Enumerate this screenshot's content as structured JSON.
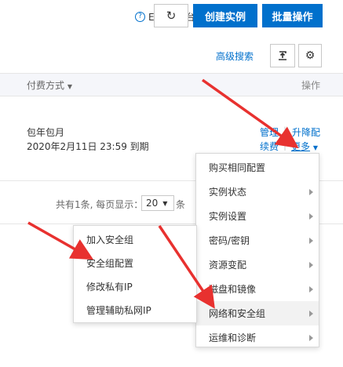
{
  "header": {
    "help_text": "ECS控制台操作指南",
    "refresh_icon": "refresh-icon",
    "create_label": "创建实例",
    "batch_label": "批量操作",
    "primary_color": "#0070cc"
  },
  "toolbar": {
    "advanced_search": "高级搜索",
    "export_icon": "export-icon",
    "settings_icon": "gear-icon"
  },
  "table": {
    "col_billing": "付费方式",
    "col_actions": "操作",
    "row": {
      "billing_type": "包年包月",
      "expire_text": "2020年2月11日 23:59 到期",
      "actions": {
        "manage": "管理",
        "upgrade": "升降配",
        "renew": "续费",
        "more": "更多",
        "separator": "|"
      }
    }
  },
  "pagination": {
    "summary": "共有1条, 每页显示：",
    "page_size": "20",
    "unit": "条"
  },
  "more_menu": {
    "items": [
      {
        "label": "购买相同配置",
        "has_sub": false
      },
      {
        "label": "实例状态",
        "has_sub": true
      },
      {
        "label": "实例设置",
        "has_sub": true
      },
      {
        "label": "密码/密钥",
        "has_sub": true
      },
      {
        "label": "资源变配",
        "has_sub": true
      },
      {
        "label": "磁盘和镜像",
        "has_sub": true
      },
      {
        "label": "网络和安全组",
        "has_sub": true,
        "active": true
      },
      {
        "label": "运维和诊断",
        "has_sub": true
      }
    ]
  },
  "network_submenu": {
    "items": [
      {
        "label": "加入安全组"
      },
      {
        "label": "安全组配置"
      },
      {
        "label": "修改私有IP"
      },
      {
        "label": "管理辅助私网IP"
      }
    ]
  },
  "annotation_color": "#e8312f"
}
